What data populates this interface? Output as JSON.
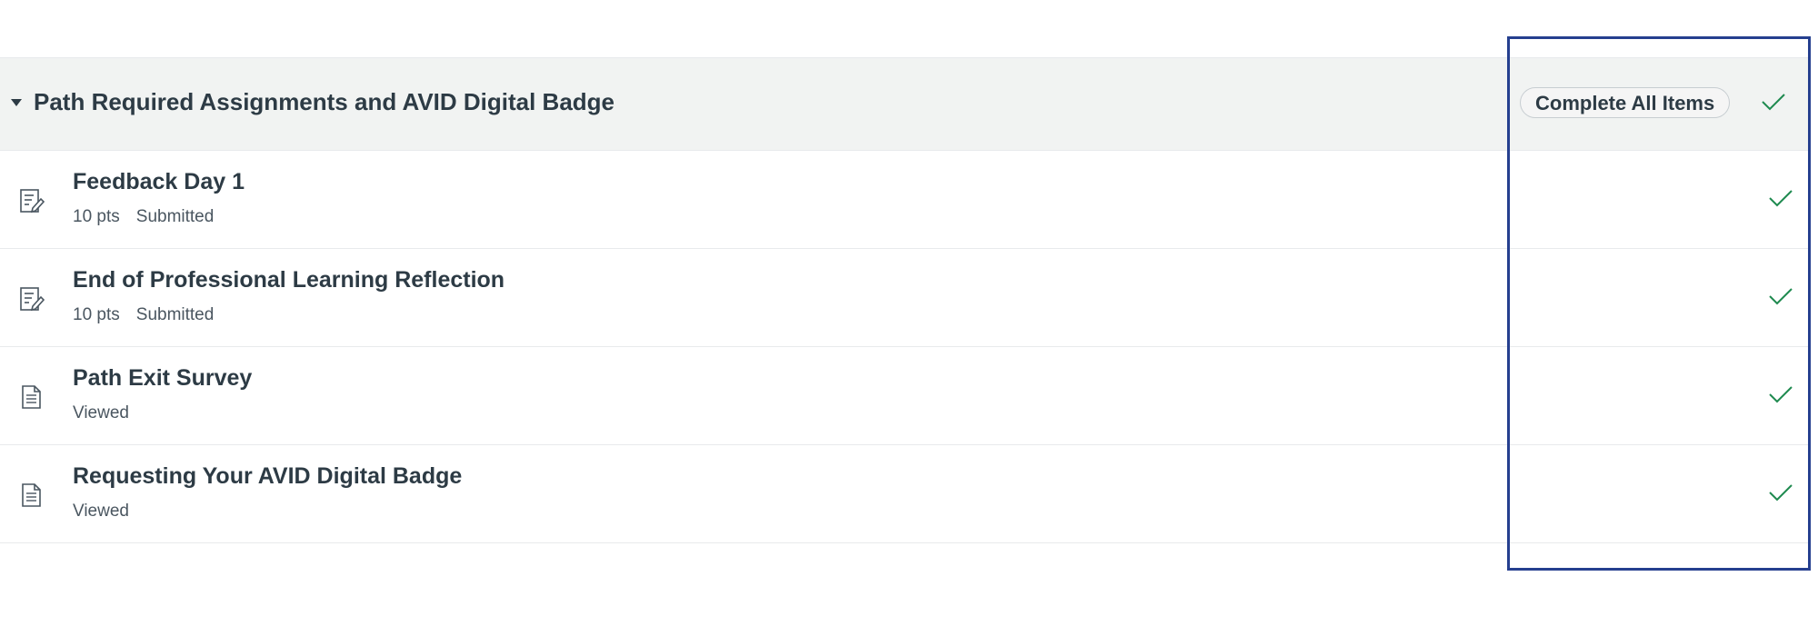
{
  "module": {
    "title": "Path Required Assignments and AVID Digital Badge",
    "requirement": "Complete All Items",
    "completed": true
  },
  "items": [
    {
      "title": "Feedback Day 1",
      "points": "10 pts",
      "status": "Submitted",
      "icon": "assignment-icon",
      "completed": true
    },
    {
      "title": "End of Professional Learning Reflection",
      "points": "10 pts",
      "status": "Submitted",
      "icon": "assignment-icon",
      "completed": true
    },
    {
      "title": "Path Exit Survey",
      "points": "",
      "status": "Viewed",
      "icon": "page-icon",
      "completed": true
    },
    {
      "title": "Requesting Your AVID Digital Badge",
      "points": "",
      "status": "Viewed",
      "icon": "page-icon",
      "completed": true
    }
  ],
  "colors": {
    "check": "#1e8a4f",
    "highlight": "#253f8f",
    "header_bg": "#f1f3f2"
  }
}
